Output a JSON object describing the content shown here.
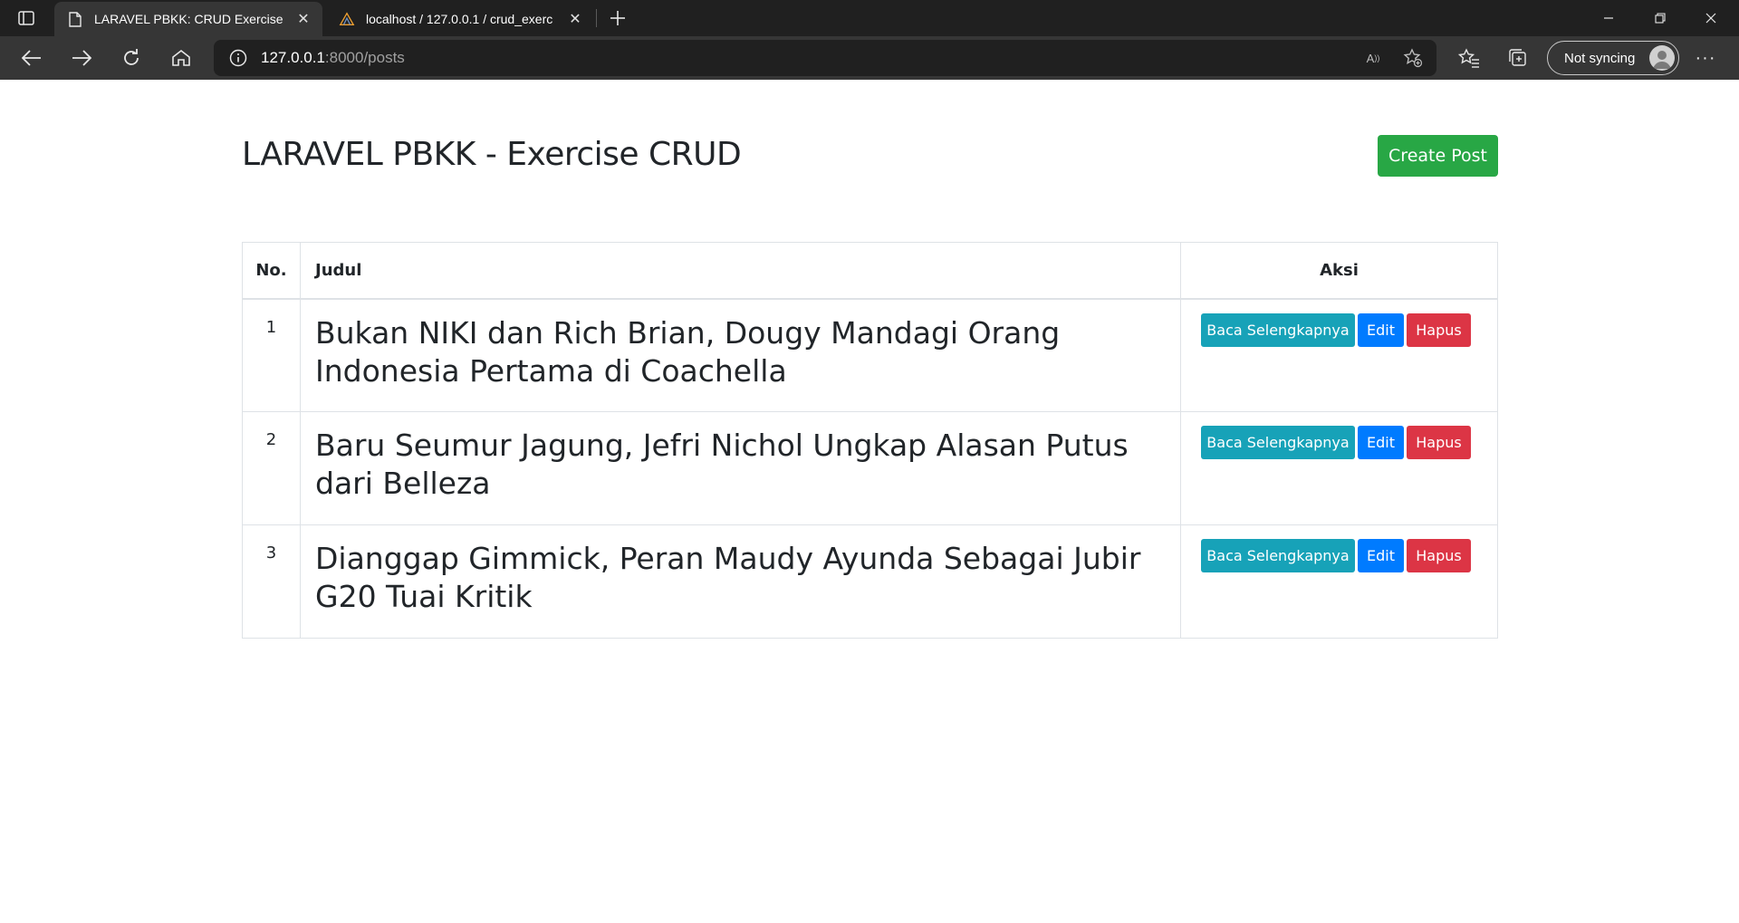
{
  "browser": {
    "tabs": [
      {
        "title": "LARAVEL PBKK: CRUD Exercise",
        "icon": "page-icon",
        "active": true
      },
      {
        "title": "localhost / 127.0.0.1 / crud_exerc",
        "icon": "phpmyadmin-icon",
        "active": false
      }
    ],
    "address": {
      "host": "127.0.0.1",
      "rest": ":8000/posts"
    },
    "sync_label": "Not syncing"
  },
  "page": {
    "title": "LARAVEL PBKK - Exercise CRUD",
    "create_label": "Create Post",
    "table": {
      "headers": {
        "no": "No.",
        "judul": "Judul",
        "aksi": "Aksi"
      },
      "rows": [
        {
          "no": "1",
          "judul": "Bukan NIKI dan Rich Brian, Dougy Mandagi Orang Indonesia Pertama di Coachella"
        },
        {
          "no": "2",
          "judul": "Baru Seumur Jagung, Jefri Nichol Ungkap Alasan Putus dari Belleza"
        },
        {
          "no": "3",
          "judul": "Dianggap Gimmick, Peran Maudy Ayunda Sebagai Jubir G20 Tuai Kritik"
        }
      ],
      "actions": {
        "read": "Baca Selengkapnya",
        "edit": "Edit",
        "delete": "Hapus"
      }
    }
  },
  "colors": {
    "success": "#28a745",
    "info": "#17a2b8",
    "primary": "#007bff",
    "danger": "#dc3545"
  }
}
